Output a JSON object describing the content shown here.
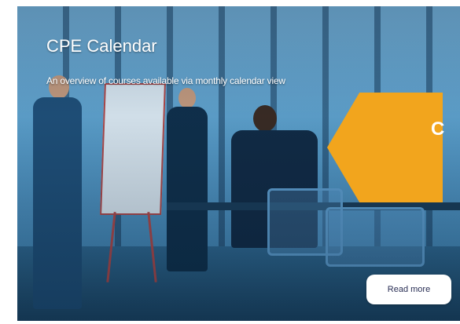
{
  "card": {
    "title": "CPE Calendar",
    "subtitle": "An overview of courses available via monthly calendar view",
    "banner_text": "C",
    "read_more_label": "Read more",
    "accent_color": "#f2a51d",
    "image": "office-meeting-photo"
  }
}
